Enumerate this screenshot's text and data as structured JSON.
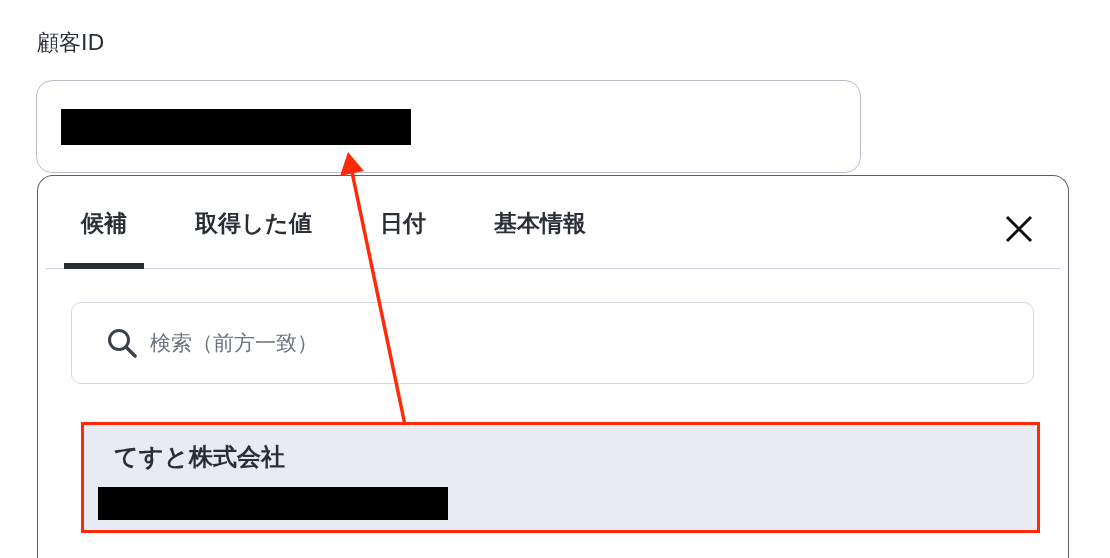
{
  "field": {
    "label": "顧客ID"
  },
  "panel": {
    "tabs": [
      {
        "label": "候補",
        "selected": true
      },
      {
        "label": "取得した値",
        "selected": false
      },
      {
        "label": "日付",
        "selected": false
      },
      {
        "label": "基本情報",
        "selected": false
      }
    ],
    "search": {
      "placeholder": "検索（前方一致）"
    },
    "items": [
      {
        "name": "てすと株式会社",
        "highlighted": true
      }
    ]
  }
}
